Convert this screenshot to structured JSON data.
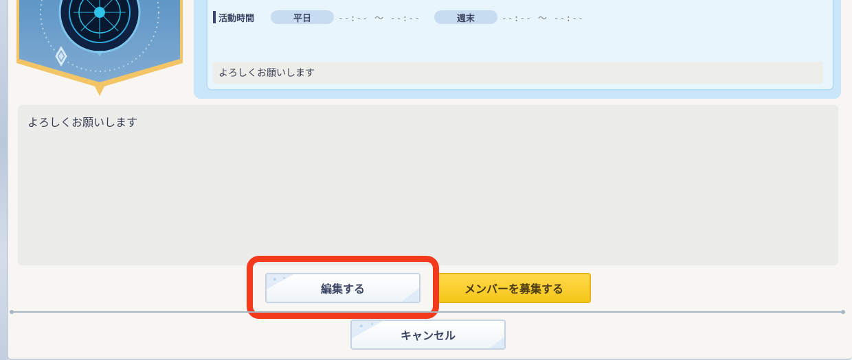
{
  "activity": {
    "label": "活動時間",
    "weekday_label": "平日",
    "weekday_time": "--:-- ～ --:--",
    "weekend_label": "週末",
    "weekend_time": "--:-- ～ --:--"
  },
  "short_message": "よろしくお願いします",
  "message": "よろしくお願いします",
  "buttons": {
    "edit": "編集する",
    "recruit": "メンバーを募集する",
    "cancel": "キャンセル"
  },
  "colors": {
    "highlight": "#f33a1c",
    "recruit_button": "#f5c71a",
    "info_box": "#c9e6fa"
  }
}
